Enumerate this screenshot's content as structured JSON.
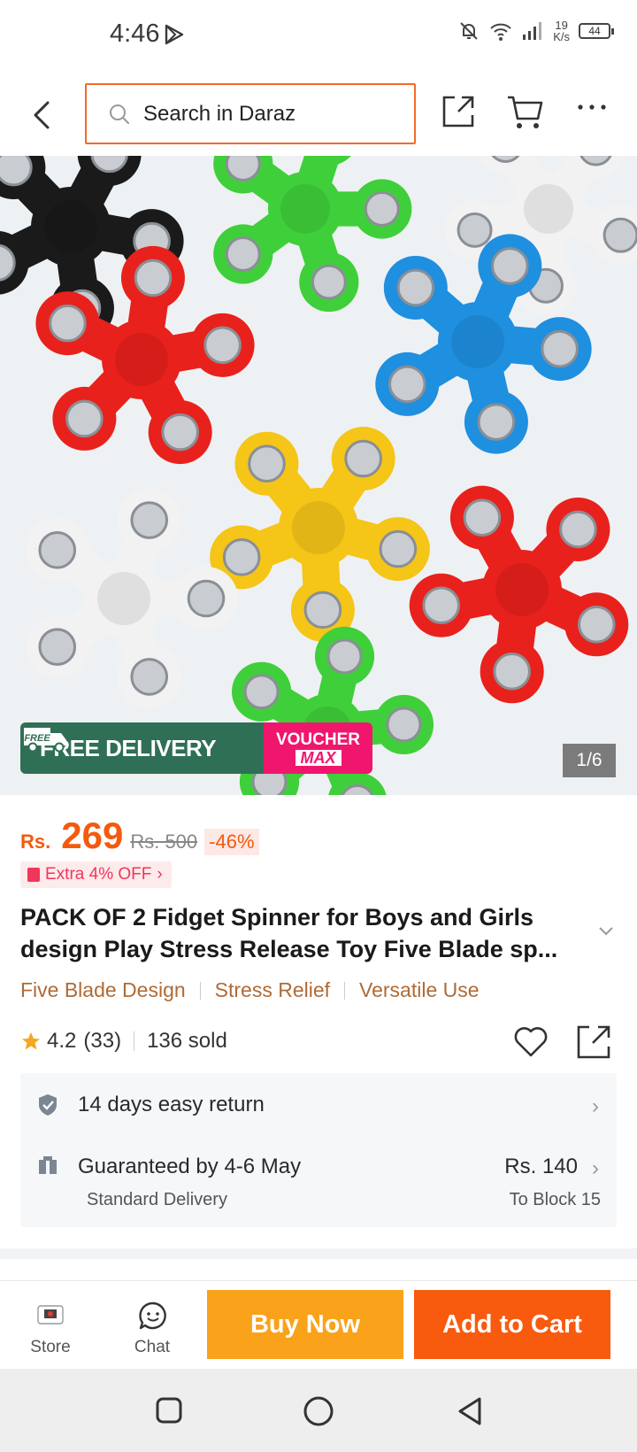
{
  "status_bar": {
    "time": "4:46",
    "net_speed_value": "19",
    "net_speed_unit": "K/s",
    "battery": "44"
  },
  "header": {
    "search_placeholder": "Search in Daraz",
    "icons": [
      "back-arrow-icon",
      "search-icon",
      "share-icon",
      "cart-icon",
      "more-icon"
    ]
  },
  "gallery": {
    "counter": "1/6",
    "banner": {
      "free_badge": "FREE",
      "free_delivery": "FREE DELIVERY",
      "voucher_top": "VOUCHER",
      "voucher_bottom": "MAX"
    }
  },
  "product": {
    "currency": "Rs.",
    "price": "269",
    "original_price": "Rs. 500",
    "discount": "-46%",
    "extra_off": "Extra 4% OFF",
    "title": "PACK OF 2 Fidget Spinner for Boys and Girls design Play Stress Release Toy Five Blade sp...",
    "tags": [
      "Five Blade Design",
      "Stress Relief",
      "Versatile Use"
    ],
    "rating": "4.2",
    "rating_count": "(33)",
    "sold": "136 sold"
  },
  "service": {
    "return_text": "14 days easy return",
    "delivery_text": "Guaranteed by 4-6 May",
    "delivery_type": "Standard Delivery",
    "delivery_price": "Rs. 140",
    "delivery_to": "To Block 15"
  },
  "bottom_bar": {
    "store_label": "Store",
    "chat_label": "Chat",
    "buy_now": "Buy Now",
    "add_to_cart": "Add to Cart"
  },
  "colors": {
    "accent": "#f85b0e",
    "buy_now": "#f9a21a",
    "search_border": "#f36a2a",
    "tag_text": "#b06a35"
  }
}
